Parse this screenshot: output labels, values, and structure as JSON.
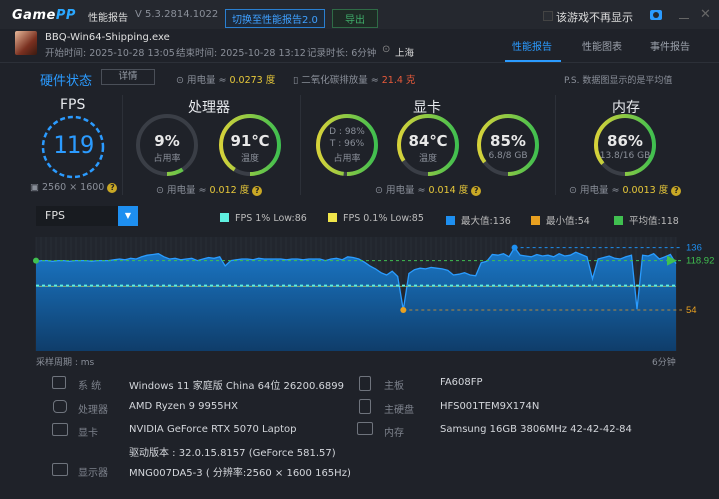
{
  "titlebar": {
    "logo": "GamePP",
    "logo_a": "Game",
    "logo_b": "PP",
    "title": "性能报告",
    "version": "V 5.3.2814.1022",
    "switch_button": "切换至性能报告2.0",
    "export_button": "导出",
    "dont_show_label": "该游戏不再显示"
  },
  "session": {
    "exe": "BBQ-Win64-Shipping.exe",
    "start": "开始时间: 2025-10-28 13:05",
    "end": "结束时间: 2025-10-28 13:12",
    "duration": "记录时长: 6分钟",
    "location": "上海"
  },
  "tabs": [
    {
      "label": "性能报告",
      "active": true
    },
    {
      "label": "性能图表"
    },
    {
      "label": "事件报告"
    }
  ],
  "hw": {
    "title": "硬件状态",
    "detail_button": "详情",
    "power_label": "用电量 ≈ ",
    "power_value": "0.0273 度",
    "co2_label": "二氧化碳排放量 ≈ ",
    "co2_value": "21.4 克",
    "note": "P.S. 数据图显示的是平均值"
  },
  "fps": {
    "title": "FPS",
    "value": "119",
    "resolution": "2560 × 1600"
  },
  "cpu": {
    "title": "处理器",
    "usage": "9%",
    "usage_label": "占用率",
    "usage_pct": 9,
    "temp": "91℃",
    "temp_label": "温度",
    "temp_pct": 91,
    "power_label": "用电量 ≈ ",
    "power_value": "0.012 度"
  },
  "gpu": {
    "title": "显卡",
    "d": "D : 98%",
    "t": "T : 96%",
    "usage_label": "占用率",
    "usage_pct": 98,
    "temp": "84℃",
    "temp_label": "温度",
    "temp_pct": 84,
    "mem": "85%",
    "mem_sub": "6.8/8 GB",
    "mem_pct": 85,
    "power_label": "用电量 ≈ ",
    "power_value": "0.014 度"
  },
  "ram": {
    "title": "内存",
    "usage": "86%",
    "sub": "13.8/16 GB",
    "pct": 86,
    "power_label": "用电量 ≈ ",
    "power_value": "0.0013 度"
  },
  "colors": {
    "accent": "#2b9bff",
    "ring_green": "#3fbf4f",
    "ring_yellow": "#d6d23a",
    "low1": "#5ff0e0",
    "low01": "#f0e54a",
    "max": "#1e8ff0",
    "min": "#e8a020",
    "avg": "#40c050"
  },
  "chart_data": {
    "type": "area",
    "metric_select": "FPS",
    "legend": [
      "FPS 1% Low:86",
      "FPS 0.1% Low:85",
      "最大值:136",
      "最小值:54",
      "平均值:118"
    ],
    "ylim": [
      0,
      150
    ],
    "max_label": "136",
    "min_label": "54",
    "avg_label": "118.92",
    "max": 136,
    "min": 54,
    "avg": 118.92,
    "low1": 86,
    "low01": 85,
    "xlabel_left": "采样周期 : ms",
    "xlabel_right": "6分钟",
    "values": [
      118,
      119,
      119,
      118,
      119,
      119,
      118,
      119,
      119,
      119,
      118,
      119,
      119,
      119,
      120,
      121,
      120,
      122,
      121,
      124,
      126,
      127,
      128,
      124,
      121,
      122,
      120,
      121,
      122,
      119,
      121,
      123,
      122,
      124,
      112,
      119,
      120,
      121,
      121,
      120,
      122,
      121,
      121,
      121,
      121,
      120,
      121,
      121,
      120,
      121,
      121,
      121,
      119,
      121,
      122,
      120,
      124,
      123,
      121,
      117,
      112,
      108,
      103,
      100,
      105,
      98,
      54,
      102,
      107,
      109,
      108,
      110,
      109,
      108,
      106,
      100,
      101,
      103,
      100,
      99,
      116,
      118,
      127,
      126,
      128,
      124,
      136,
      126,
      125,
      124,
      127,
      125,
      126,
      124,
      128,
      125,
      126,
      130,
      127,
      124,
      95,
      121,
      123,
      125,
      122,
      121,
      124,
      126,
      55,
      126,
      125,
      128,
      121,
      124,
      127,
      115
    ]
  },
  "info": {
    "os_label": "系 统",
    "os": "Windows 11 家庭版 China 64位 26200.6899",
    "cpu_label": "处理器",
    "cpu": "AMD Ryzen 9 9955HX",
    "gpu_label": "显卡",
    "gpu": "NVIDIA GeForce RTX 5070 Laptop",
    "driver": "驱动版本 : 32.0.15.8157 (GeForce 581.57)",
    "monitor_label": "显示器",
    "monitor": "MNG007DA5-3 ( 分辨率:2560 × 1600 165Hz)",
    "board_label": "主板",
    "board": "FA608FP",
    "disk_label": "主硬盘",
    "disk": "HFS001TEM9X174N",
    "mem_label": "内存",
    "mem": "Samsung 16GB 3806MHz 42-42-42-84"
  }
}
